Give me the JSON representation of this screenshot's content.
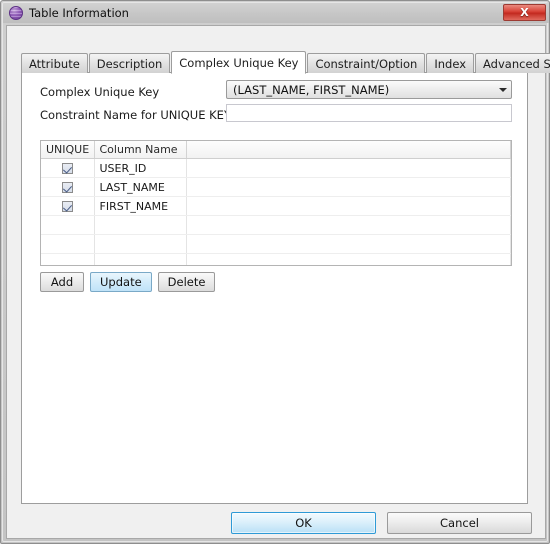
{
  "window": {
    "title": "Table Information",
    "icon": "purple-sphere-icon",
    "close_label": "X",
    "accent": "#2e9ad6",
    "titlebar_color": "#c6c6c6",
    "body_color": "#f0f0f0"
  },
  "tabs": [
    {
      "label": "Attribute",
      "active": false
    },
    {
      "label": "Description",
      "active": false
    },
    {
      "label": "Complex Unique Key",
      "active": true
    },
    {
      "label": "Constraint/Option",
      "active": false
    },
    {
      "label": "Index",
      "active": false
    },
    {
      "label": "Advanced Settings",
      "active": false
    }
  ],
  "form": {
    "complex_unique_key_label": "Complex Unique Key",
    "complex_unique_key_value": "(LAST_NAME, FIRST_NAME)",
    "constraint_name_label": "Constraint Name for UNIQUE KEY",
    "constraint_name_value": "",
    "constraint_name_placeholder": ""
  },
  "grid": {
    "columns": [
      "UNIQUE",
      "Column Name",
      ""
    ],
    "rows": [
      {
        "unique": true,
        "column_name": "USER_ID"
      },
      {
        "unique": true,
        "column_name": "LAST_NAME"
      },
      {
        "unique": true,
        "column_name": "FIRST_NAME"
      }
    ],
    "empty_row_count": 4
  },
  "row_actions": [
    {
      "label": "Add",
      "highlighted": false
    },
    {
      "label": "Update",
      "highlighted": true
    },
    {
      "label": "Delete",
      "highlighted": false
    }
  ],
  "dialog_actions": [
    {
      "label": "OK",
      "default": true
    },
    {
      "label": "Cancel",
      "default": false
    }
  ]
}
